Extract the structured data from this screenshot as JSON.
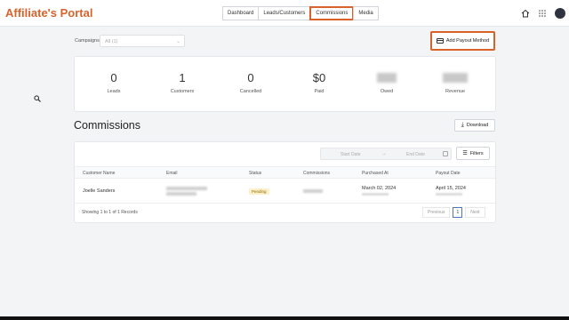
{
  "header": {
    "brand": "Affiliate's Portal",
    "tabs": [
      {
        "label": "Dashboard"
      },
      {
        "label": "Leads/Customers"
      },
      {
        "label": "Commissions"
      },
      {
        "label": "Media"
      }
    ],
    "active_tab": "Commissions",
    "icons": [
      "home-icon",
      "grid-icon",
      "avatar"
    ]
  },
  "filters": {
    "campaign_label": "Campaigns",
    "campaign_value": "All (1)"
  },
  "actions": {
    "add_payout_label": "Add Payout Method",
    "download_label": "Download",
    "filters_label": "Filters"
  },
  "stats": [
    {
      "value": "0",
      "label": "Leads"
    },
    {
      "value": "1",
      "label": "Customers"
    },
    {
      "value": "0",
      "label": "Cancelled"
    },
    {
      "value": "$0",
      "label": "Paid"
    },
    {
      "value": "",
      "label": "Owed",
      "blurred": true
    },
    {
      "value": "",
      "label": "Revenue",
      "blurred": true
    }
  ],
  "page": {
    "title": "Commissions"
  },
  "date_range": {
    "start_placeholder": "Start Date",
    "separator": "→",
    "end_placeholder": "End Date"
  },
  "table": {
    "columns": [
      "Customer Name",
      "Email",
      "Status",
      "Commissions",
      "Purchased At",
      "Payout Date"
    ],
    "rows": [
      {
        "customer_name": "Joelle Sanders",
        "email": "",
        "status": "Pending",
        "commissions": "",
        "purchased_at": "March 02, 2024",
        "payout_date": "April 15, 2024"
      }
    ],
    "records_text": "Showing 1 to 1 of 1 Records"
  },
  "pagination": {
    "previous": "Previous",
    "page": "1",
    "next": "Next"
  },
  "colors": {
    "accent": "#d9622b",
    "pending_badge_bg": "#fdf0c7",
    "active_page_border": "#4a78c2"
  }
}
